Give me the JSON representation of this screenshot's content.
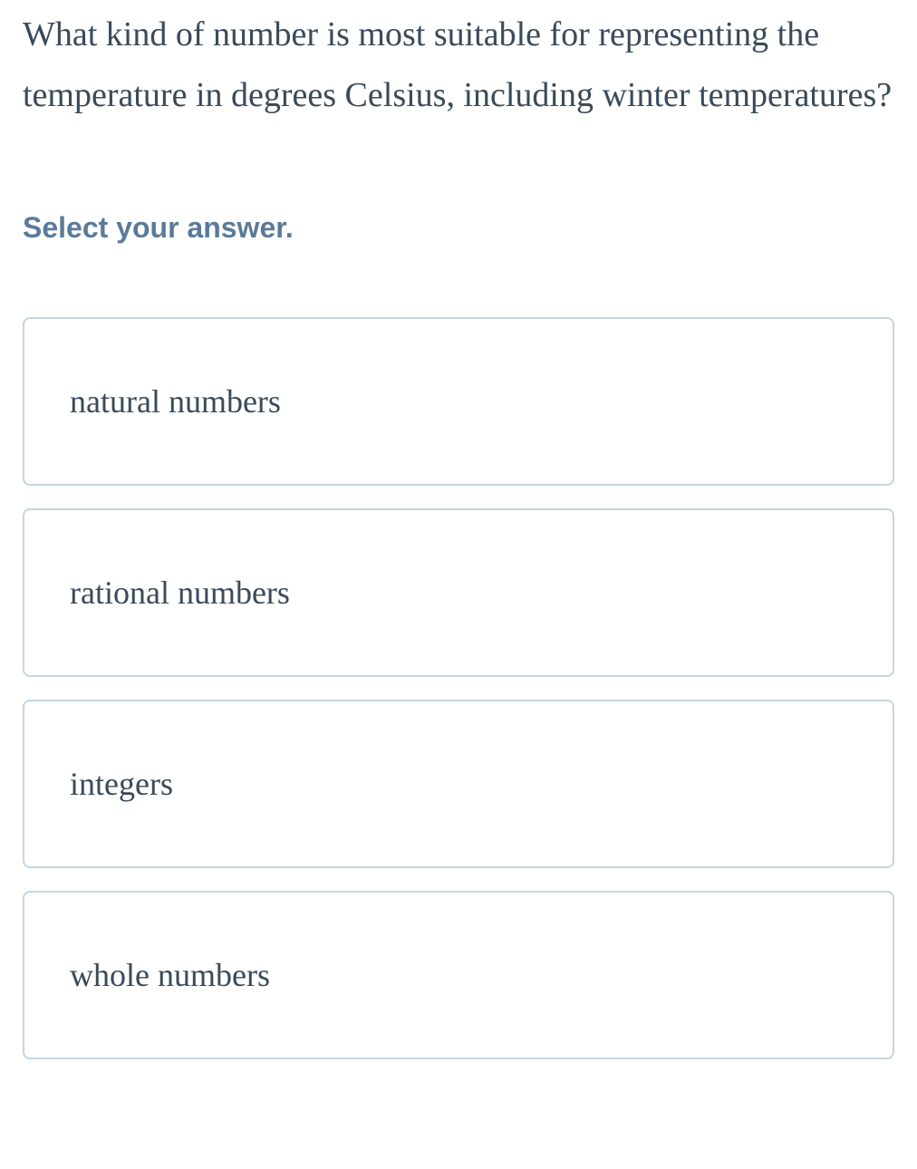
{
  "question": "What kind of number is most suitable for representing the temperature in degrees Celsius, including winter temperatures?",
  "instruction": "Select your answer.",
  "options": [
    {
      "label": "natural numbers"
    },
    {
      "label": "rational numbers"
    },
    {
      "label": "integers"
    },
    {
      "label": "whole numbers"
    }
  ]
}
